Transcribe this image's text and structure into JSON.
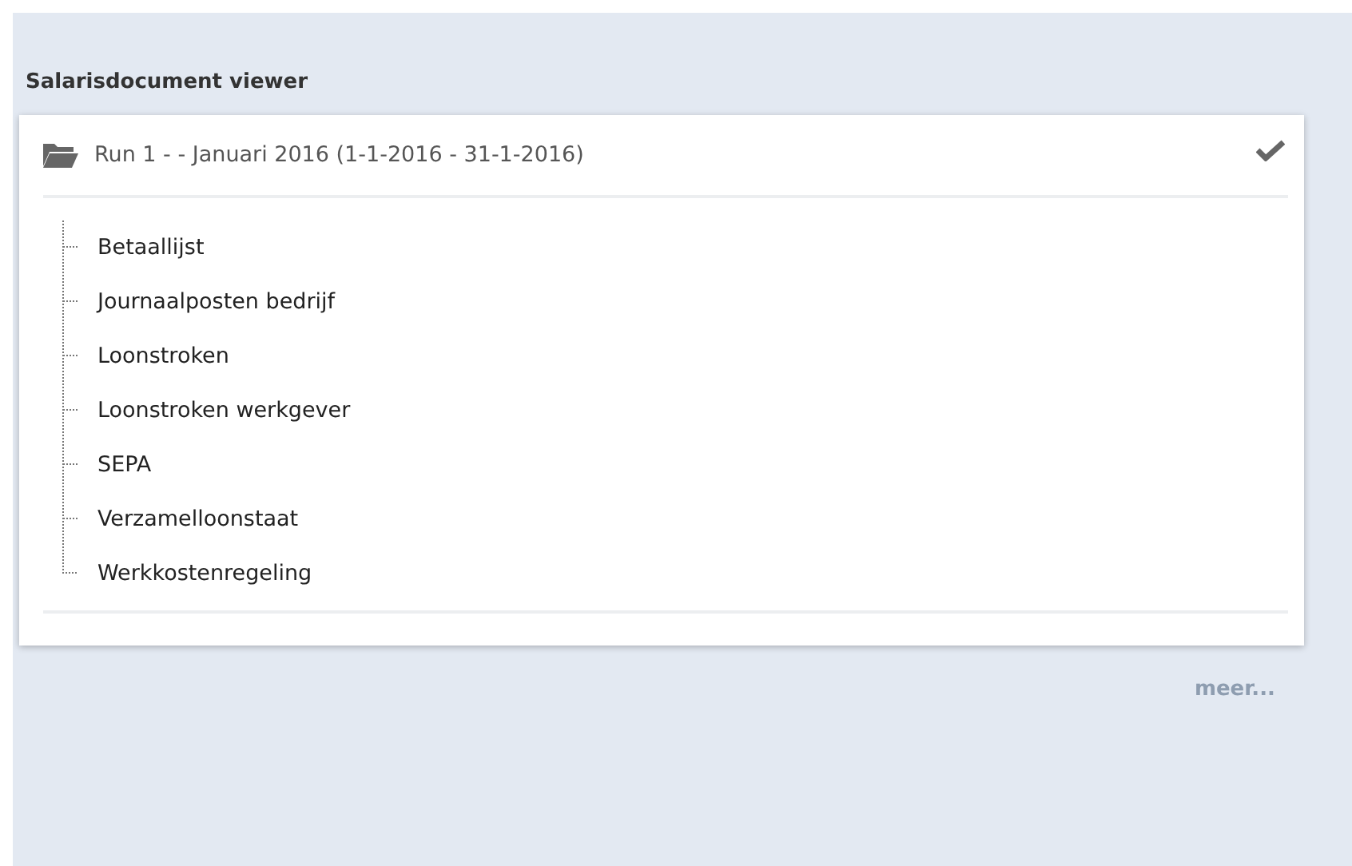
{
  "title": "Salarisdocument viewer",
  "run": {
    "label": "Run 1 - - Januari 2016 (1-1-2016 - 31-1-2016)",
    "expanded": true,
    "checked": true,
    "children": [
      {
        "label": "Betaallijst"
      },
      {
        "label": "Journaalposten bedrijf"
      },
      {
        "label": "Loonstroken"
      },
      {
        "label": "Loonstroken werkgever"
      },
      {
        "label": "SEPA"
      },
      {
        "label": "Verzamelloonstaat"
      },
      {
        "label": "Werkkostenregeling"
      }
    ]
  },
  "more_link": "meer..."
}
